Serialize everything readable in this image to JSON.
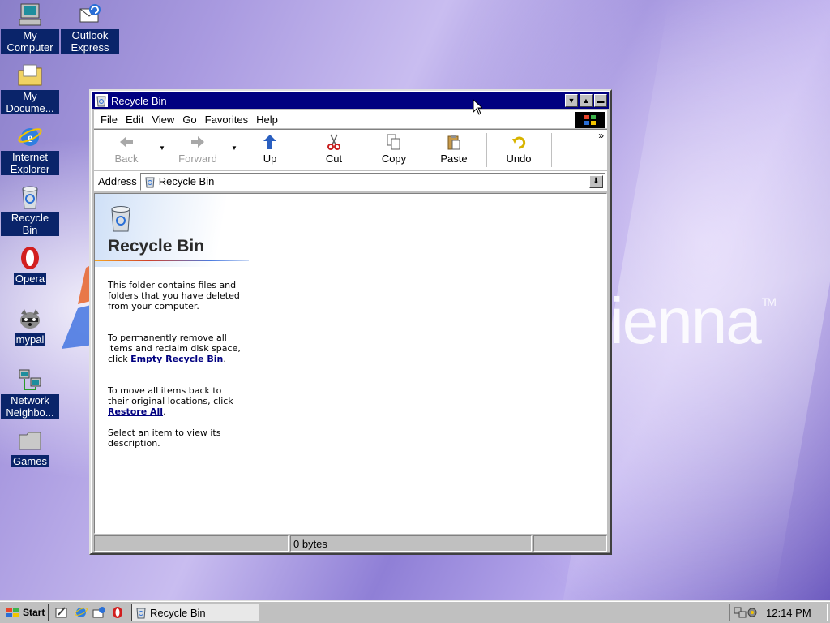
{
  "desktop": {
    "wallpaper_text": "ienna",
    "wallpaper_tm": "TM",
    "icons": [
      {
        "label": "My Computer",
        "icon": "my-computer-icon"
      },
      {
        "label": "Outlook Express",
        "icon": "outlook-express-icon"
      },
      {
        "label": "My Docume...",
        "icon": "my-documents-icon"
      },
      {
        "label": "Internet Explorer",
        "icon": "internet-explorer-icon"
      },
      {
        "label": "Recycle Bin",
        "icon": "recycle-bin-icon"
      },
      {
        "label": "Opera",
        "icon": "opera-icon"
      },
      {
        "label": "mypal",
        "icon": "mypal-icon"
      },
      {
        "label": "Network Neighbo...",
        "icon": "network-neighborhood-icon"
      },
      {
        "label": "Games",
        "icon": "games-folder-icon"
      }
    ]
  },
  "window": {
    "title": "Recycle Bin",
    "menu": [
      "File",
      "Edit",
      "View",
      "Go",
      "Favorites",
      "Help"
    ],
    "toolbar": {
      "back": "Back",
      "forward": "Forward",
      "up": "Up",
      "cut": "Cut",
      "copy": "Copy",
      "paste": "Paste",
      "undo": "Undo",
      "more": "»"
    },
    "address": {
      "label": "Address",
      "value": "Recycle Bin"
    },
    "panel": {
      "title": "Recycle Bin",
      "p1": "This folder contains files and folders that you have deleted from your computer.",
      "p2_before": "To permanently remove all items and reclaim disk space, click ",
      "p2_link": "Empty Recycle Bin",
      "p2_after": ".",
      "p3_before": "To move all items back to their original locations, click ",
      "p3_link": "Restore All",
      "p3_after": ".",
      "p4": "Select an item to view its description."
    },
    "status": {
      "size": "0 bytes"
    }
  },
  "taskbar": {
    "start_label": "Start",
    "task_title": "Recycle Bin",
    "clock": "12:14 PM"
  },
  "colors": {
    "titlebar": "#000080",
    "selection": "#0a246a",
    "link": "#000080"
  }
}
